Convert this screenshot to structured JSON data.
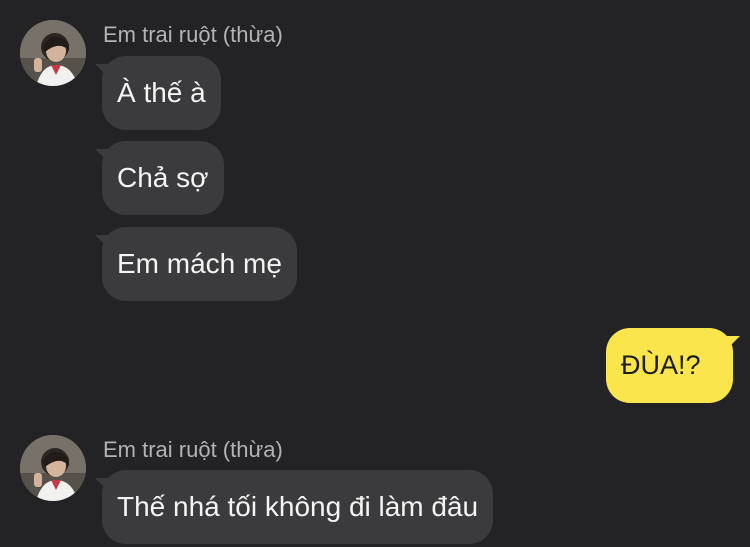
{
  "messages": [
    {
      "sender": "Em trai ruột (thừa)",
      "side": "incoming",
      "bubbles": [
        "À thế à",
        "Chả sợ",
        "Em mách mẹ"
      ]
    },
    {
      "side": "outgoing",
      "bubbles": [
        "ĐÙA!?"
      ]
    },
    {
      "sender": "Em trai ruột (thừa)",
      "side": "incoming",
      "bubbles": [
        "Thế nhá tối không đi làm đâu"
      ]
    }
  ],
  "colors": {
    "background": "#232325",
    "incoming_bubble": "#3b3b3d",
    "outgoing_bubble": "#fae64c",
    "sender_name": "#b3b3b6"
  },
  "icons": {
    "avatar": "profile-photo"
  }
}
